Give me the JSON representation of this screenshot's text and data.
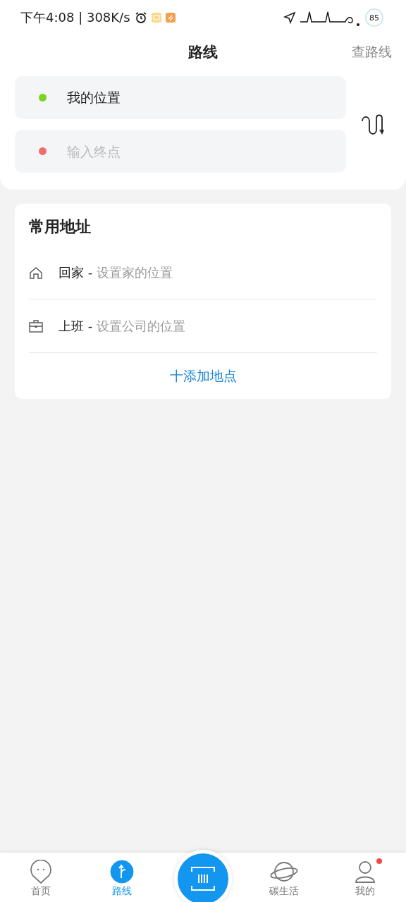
{
  "status_bar": {
    "time": "下午4:08 | 308K/s",
    "battery": "85"
  },
  "header": {
    "title": "路线",
    "action": "查路线"
  },
  "route": {
    "start": {
      "value": "我的位置",
      "color": "#7ed321"
    },
    "end": {
      "placeholder": "输入终点",
      "color": "#f56c6c"
    }
  },
  "common_addresses": {
    "title": "常用地址",
    "items": [
      {
        "kind": "home",
        "label": "回家 -",
        "hint": "设置家的位置"
      },
      {
        "kind": "work",
        "label": "上班 -",
        "hint": "设置公司的位置"
      }
    ],
    "add_button": "十添加地点"
  },
  "tab_bar": [
    {
      "kind": "home",
      "label": "首页",
      "selected": false,
      "dot": false
    },
    {
      "kind": "route",
      "label": "路线",
      "selected": true,
      "dot": false
    },
    {
      "kind": "scan"
    },
    {
      "kind": "planet",
      "label": "碳生活",
      "selected": false,
      "dot": false
    },
    {
      "kind": "profile",
      "label": "我的",
      "selected": false,
      "dot": true
    }
  ]
}
